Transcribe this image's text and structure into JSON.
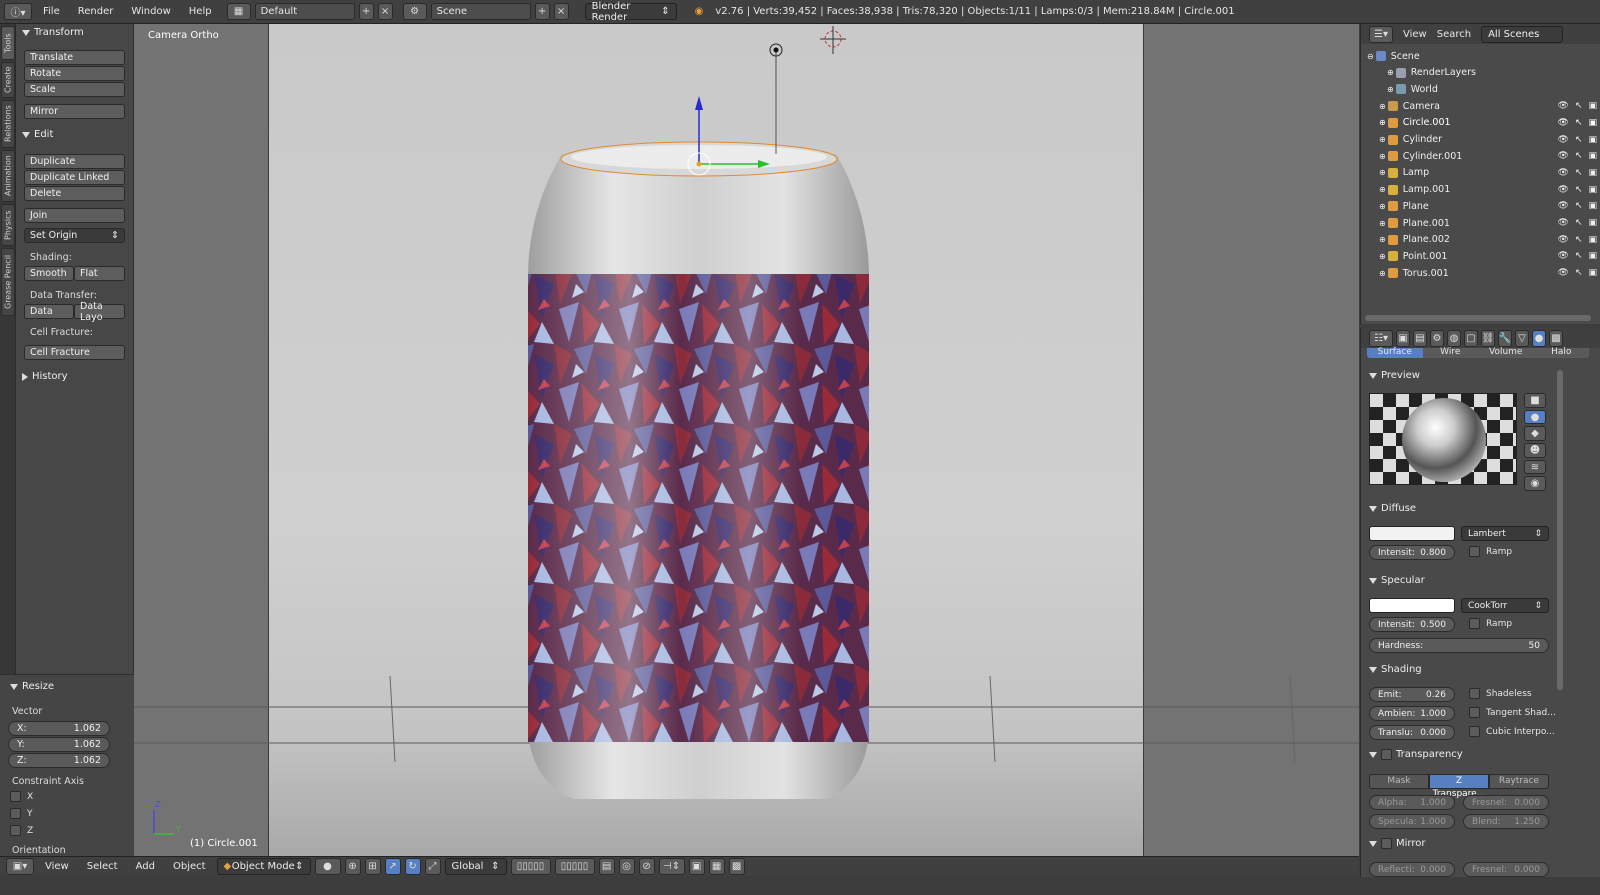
{
  "topbar": {
    "menus": [
      "File",
      "Render",
      "Window",
      "Help"
    ],
    "screen_layout": "Default",
    "scene": "Scene",
    "render_engine": "Blender Render",
    "stats": "v2.76 | Verts:39,452 | Faces:38,938 | Tris:78,320 | Objects:1/11 | Lamps:0/3 | Mem:218.84M | Circle.001"
  },
  "vtabs": [
    "Tools",
    "Create",
    "Relations",
    "Animation",
    "Physics",
    "Grease Pencil"
  ],
  "toolshelf": {
    "transform_header": "Transform",
    "translate": "Translate",
    "rotate": "Rotate",
    "scale": "Scale",
    "mirror": "Mirror",
    "edit_header": "Edit",
    "duplicate": "Duplicate",
    "duplicate_linked": "Duplicate Linked",
    "delete": "Delete",
    "join": "Join",
    "set_origin": "Set Origin",
    "shading_label": "Shading:",
    "smooth": "Smooth",
    "flat": "Flat",
    "data_transfer_label": "Data Transfer:",
    "data": "Data",
    "data_layout": "Data Layo",
    "cell_fracture_label": "Cell Fracture:",
    "cell_fracture": "Cell Fracture",
    "history_header": "History"
  },
  "resize_panel": {
    "header": "Resize",
    "vector_label": "Vector",
    "x_label": "X:",
    "x": "1.062",
    "y_label": "Y:",
    "y": "1.062",
    "z_label": "Z:",
    "z": "1.062",
    "constraint_label": "Constraint Axis",
    "axis_x": "X",
    "axis_y": "Y",
    "axis_z": "Z",
    "orientation_label": "Orientation"
  },
  "viewport": {
    "view_name": "Camera Ortho",
    "active_object": "(1) Circle.001",
    "axis_z": "Z",
    "axis_y": "Y"
  },
  "bottombar": {
    "menus": [
      "View",
      "Select",
      "Add",
      "Object"
    ],
    "mode": "Object Mode",
    "orientation": "Global"
  },
  "outliner": {
    "view": "View",
    "search": "Search",
    "scenes": "All Scenes",
    "items": [
      {
        "name": "Scene",
        "type": "scene"
      },
      {
        "name": "RenderLayers",
        "type": "render"
      },
      {
        "name": "World",
        "type": "world"
      },
      {
        "name": "Camera",
        "type": "camera"
      },
      {
        "name": "Circle.001",
        "type": "mesh"
      },
      {
        "name": "Cylinder",
        "type": "mesh"
      },
      {
        "name": "Cylinder.001",
        "type": "mesh"
      },
      {
        "name": "Lamp",
        "type": "lamp"
      },
      {
        "name": "Lamp.001",
        "type": "lamp"
      },
      {
        "name": "Plane",
        "type": "mesh"
      },
      {
        "name": "Plane.001",
        "type": "mesh"
      },
      {
        "name": "Plane.002",
        "type": "mesh"
      },
      {
        "name": "Point.001",
        "type": "lamp"
      },
      {
        "name": "Torus.001",
        "type": "mesh"
      }
    ]
  },
  "properties": {
    "tabs": [
      "Surface",
      "Wire",
      "Volume",
      "Halo"
    ],
    "preview_header": "Preview",
    "diffuse_header": "Diffuse",
    "diffuse_shader": "Lambert",
    "diffuse_intensity_label": "Intensit:",
    "diffuse_intensity": "0.800",
    "ramp": "Ramp",
    "specular_header": "Specular",
    "specular_shader": "CookTorr",
    "specular_intensity_label": "Intensit:",
    "specular_intensity": "0.500",
    "hardness_label": "Hardness:",
    "hardness": "50",
    "shading_header": "Shading",
    "emit_label": "Emit:",
    "emit": "0.26",
    "ambient_label": "Ambien:",
    "ambient": "1.000",
    "translucency_label": "Translu:",
    "translucency": "0.000",
    "shadeless": "Shadeless",
    "tangent_shading": "Tangent Shad...",
    "cubic_interp": "Cubic Interpo...",
    "transparency_header": "Transparency",
    "mask": "Mask",
    "z_transparency": "Z Transpare...",
    "raytrace": "Raytrace",
    "alpha_label": "Alpha:",
    "alpha": "1.000",
    "fresnel_label": "Fresnel:",
    "fresnel": "0.000",
    "specular_label": "Specula:",
    "specular_val": "1.000",
    "blend_label": "Blend:",
    "blend": "1.250",
    "mirror_header": "Mirror",
    "reflect_label": "Reflecti:",
    "reflect": "0.000",
    "mirror_fresnel_label": "Fresnel:",
    "mirror_fresnel": "0.000"
  },
  "colors": {
    "accent_blue": "#5680c2",
    "selected_text": "#ffffff"
  }
}
